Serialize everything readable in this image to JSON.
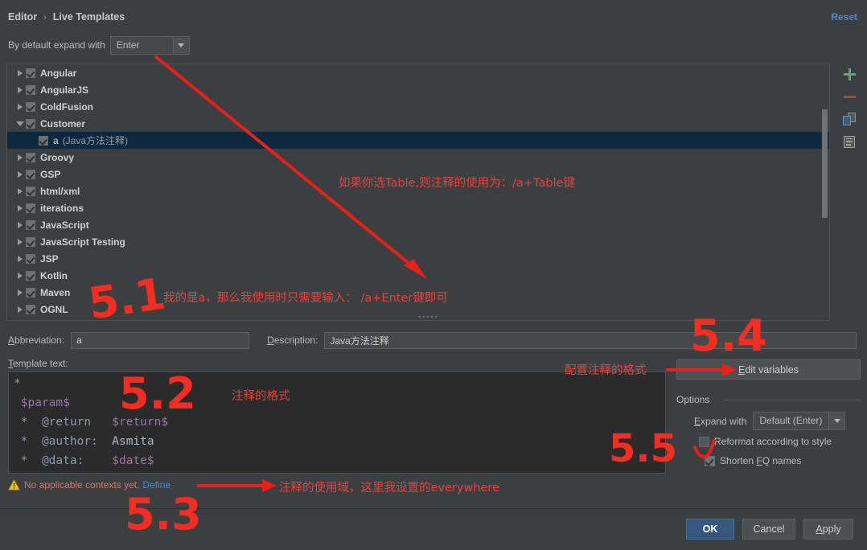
{
  "window": {
    "breadcrumb_root": "Editor",
    "breadcrumb_sep": "›",
    "breadcrumb_leaf": "Live Templates",
    "reset_label": "Reset"
  },
  "expand": {
    "label": "By default expand with",
    "value": "Enter"
  },
  "tree": {
    "items": [
      {
        "label": "Angular",
        "desc": "",
        "expanded": false,
        "child": false,
        "checked": true,
        "selected": false
      },
      {
        "label": "AngularJS",
        "desc": "",
        "expanded": false,
        "child": false,
        "checked": true,
        "selected": false
      },
      {
        "label": "ColdFusion",
        "desc": "",
        "expanded": false,
        "child": false,
        "checked": true,
        "selected": false
      },
      {
        "label": "Customer",
        "desc": "",
        "expanded": true,
        "child": false,
        "checked": true,
        "selected": false
      },
      {
        "label": "a",
        "desc": "(Java方法注释)",
        "expanded": false,
        "child": true,
        "checked": true,
        "selected": true
      },
      {
        "label": "Groovy",
        "desc": "",
        "expanded": false,
        "child": false,
        "checked": true,
        "selected": false
      },
      {
        "label": "GSP",
        "desc": "",
        "expanded": false,
        "child": false,
        "checked": true,
        "selected": false
      },
      {
        "label": "html/xml",
        "desc": "",
        "expanded": false,
        "child": false,
        "checked": true,
        "selected": false
      },
      {
        "label": "iterations",
        "desc": "",
        "expanded": false,
        "child": false,
        "checked": true,
        "selected": false
      },
      {
        "label": "JavaScript",
        "desc": "",
        "expanded": false,
        "child": false,
        "checked": true,
        "selected": false
      },
      {
        "label": "JavaScript Testing",
        "desc": "",
        "expanded": false,
        "child": false,
        "checked": true,
        "selected": false
      },
      {
        "label": "JSP",
        "desc": "",
        "expanded": false,
        "child": false,
        "checked": true,
        "selected": false
      },
      {
        "label": "Kotlin",
        "desc": "",
        "expanded": false,
        "child": false,
        "checked": true,
        "selected": false
      },
      {
        "label": "Maven",
        "desc": "",
        "expanded": false,
        "child": false,
        "checked": true,
        "selected": false
      },
      {
        "label": "OGNL",
        "desc": "",
        "expanded": false,
        "child": false,
        "checked": true,
        "selected": false
      }
    ]
  },
  "toolbar": {
    "add_icon": "plus-icon",
    "remove_icon": "minus-icon",
    "copy_icon": "copy-icon",
    "document_icon": "document-icon"
  },
  "form": {
    "abbreviation_label": "Abbreviation:",
    "abbreviation_value": "a",
    "description_label": "Description:",
    "description_value": "Java方法注释",
    "template_text_label": "Template text:"
  },
  "editor": {
    "lines": [
      {
        "text": "*",
        "indent": 0
      },
      {
        "text": " $param$",
        "indent": 0
      },
      {
        "text": " *  @return   $return$",
        "indent": 0
      },
      {
        "text": " *  @author:  Asmita",
        "indent": 0
      },
      {
        "text": " *  @data:    $date$",
        "indent": 0
      }
    ]
  },
  "right_panel": {
    "edit_variables_label": "Edit variables",
    "options_legend": "Options",
    "expand_with_label": "Expand with",
    "expand_with_value": "Default (Enter)",
    "reformat_label": "Reformat according to style",
    "reformat_checked": false,
    "shorten_label": "Shorten FQ names",
    "shorten_checked": true
  },
  "warning": {
    "icon": "warning-triangle-icon",
    "text": "No applicable contexts yet.",
    "define_link": "Define"
  },
  "buttons": {
    "ok": "OK",
    "cancel": "Cancel",
    "apply": "Apply"
  },
  "annotations": {
    "note_table": "如果你选Table,则注释的使用为：/a+Table键",
    "note_enter": "我的是a，那么我使用时只需要输入：  /a+Enter键即可",
    "note_format": "注释的格式",
    "note_config_format": "配置注释的格式",
    "note_scope": "注释的使用域，这里我设置的everywhere",
    "num_51": "5.1",
    "num_52": "5.2",
    "num_53": "5.3",
    "num_54": "5.4",
    "num_55": "5.5",
    "color": "#f22d22"
  }
}
